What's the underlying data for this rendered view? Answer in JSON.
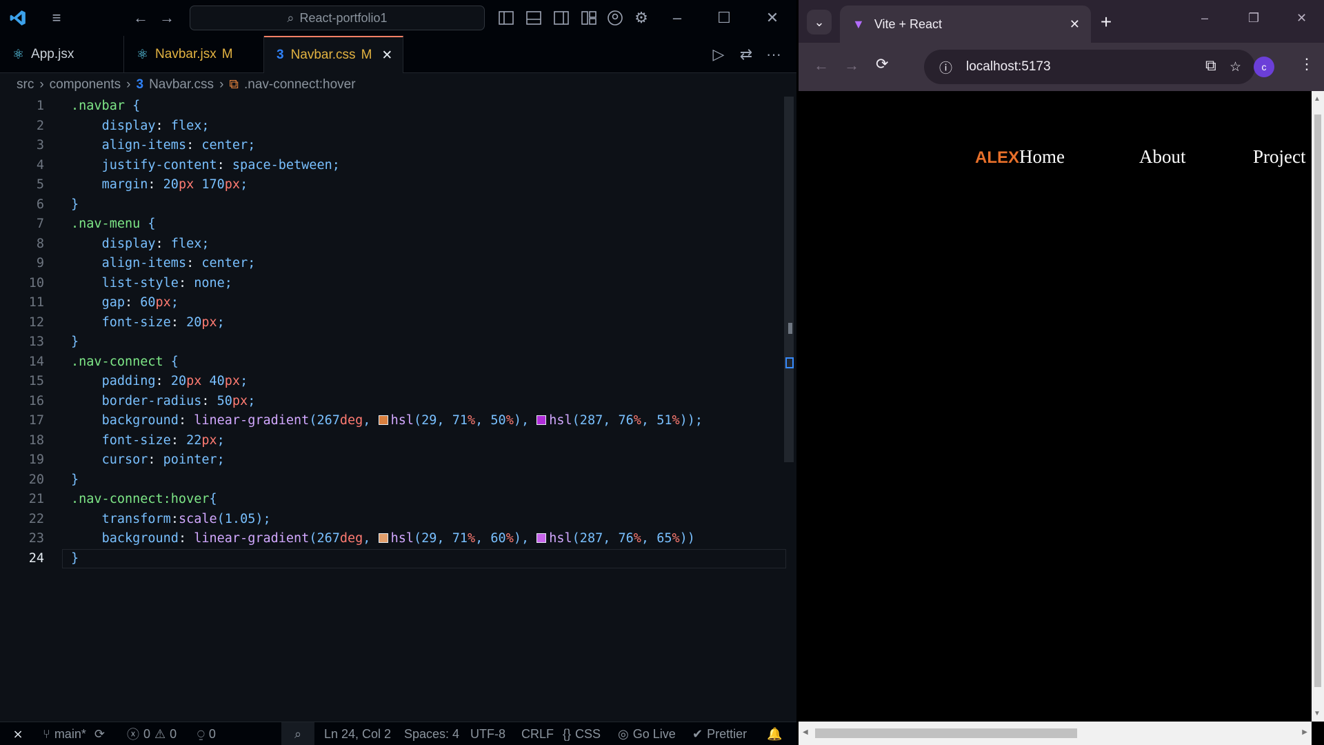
{
  "vscode": {
    "search_box": "React-portfolio1",
    "tabs": [
      {
        "label": "App.jsx",
        "badge": ""
      },
      {
        "label": "Navbar.jsx",
        "badge": "M"
      },
      {
        "label": "Navbar.css",
        "badge": "M"
      }
    ],
    "breadcrumb": [
      "src",
      "components",
      "Navbar.css",
      ".nav-connect:hover"
    ],
    "code_lines": [
      ".navbar {",
      "    display: flex;",
      "    align-items: center;",
      "    justify-content: space-between;",
      "    margin: 20px 170px;",
      "}",
      ".nav-menu {",
      "    display: flex;",
      "    align-items: center;",
      "    list-style: none;",
      "    gap: 60px;",
      "    font-size: 20px;",
      "}",
      ".nav-connect {",
      "    padding: 20px 40px;",
      "    border-radius: 50px;",
      "    background: linear-gradient(267deg, hsl(29, 71%, 50%), hsl(287, 76%, 51%));",
      "    font-size: 22px;",
      "    cursor: pointer;",
      "}",
      ".nav-connect:hover{",
      "    transform:scale(1.05);",
      "    background: linear-gradient(267deg, hsl(29, 71%, 60%), hsl(287, 76%, 65%))",
      "}"
    ],
    "swatches": {
      "orange": "#d9803f",
      "purple": "#b02ed9",
      "orange_light": "#e29f6c",
      "purple_light": "#c765ea"
    },
    "status": {
      "branch": "main*",
      "errors": "0",
      "warnings": "0",
      "ports": "0",
      "position": "Ln 24, Col 2",
      "spaces": "Spaces: 4",
      "encoding": "UTF-8",
      "eol": "CRLF",
      "language": "CSS",
      "golive": "Go Live",
      "prettier": "Prettier"
    }
  },
  "chrome": {
    "tab_title": "Vite + React",
    "url": "localhost:5173",
    "profile_initial": "c"
  },
  "page": {
    "logo": "ALEX",
    "nav_items": [
      "Home",
      "About",
      "Project"
    ],
    "logo_color": "#e8702a"
  }
}
